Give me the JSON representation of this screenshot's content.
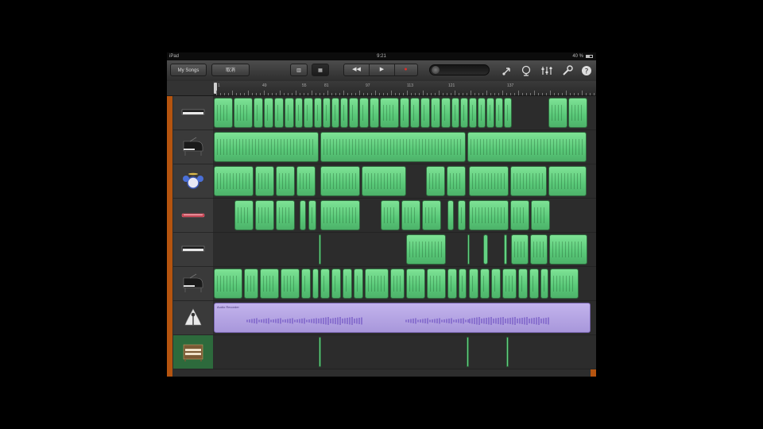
{
  "status_bar": {
    "device": "iPad",
    "time": "9:21",
    "battery": "40 %"
  },
  "toolbar": {
    "my_songs_label": "My Songs",
    "undo_label": "取消",
    "view_tracks_label": "▥",
    "view_mixer_label": "▦",
    "rewind_label": "◀◀",
    "play_label": "▶",
    "record_label": "●",
    "icons": [
      "loop-icon",
      "metronome-icon",
      "mixer-icon",
      "settings-icon",
      "help-icon"
    ]
  },
  "ruler": {
    "bar_labels": [
      "1",
      "49",
      "55",
      "81",
      "97",
      "113",
      "121",
      "137"
    ]
  },
  "tracks": [
    {
      "instrument": "keyboard-icon",
      "color": "#59c878"
    },
    {
      "instrument": "grand-piano-icon",
      "color": "#59c878"
    },
    {
      "instrument": "drum-kit-icon",
      "color": "#59c878"
    },
    {
      "instrument": "synth-lead-icon",
      "color": "#59c878"
    },
    {
      "instrument": "keyboard-icon",
      "color": "#59c878"
    },
    {
      "instrument": "grand-piano-icon",
      "color": "#59c878"
    },
    {
      "instrument": "audio-recorder-icon",
      "color": "#a897db",
      "region_label": "Audio Recorder"
    },
    {
      "instrument": "organ-icon",
      "color": "#59c878",
      "selected": true
    }
  ],
  "colors": {
    "accent": "#b5540f",
    "midi_region": "#59c878",
    "audio_region": "#a897db",
    "record": "#e0302a"
  }
}
